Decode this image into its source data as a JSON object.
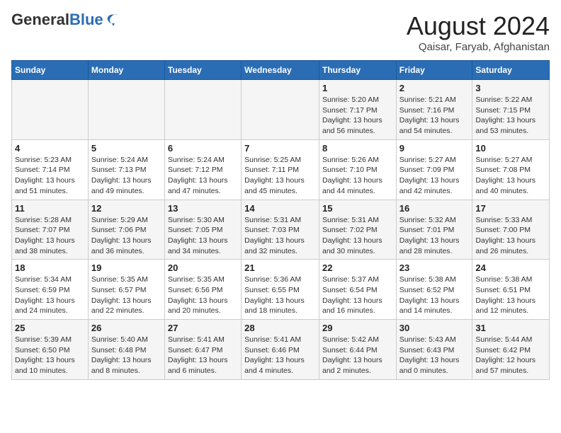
{
  "header": {
    "logo_general": "General",
    "logo_blue": "Blue",
    "main_title": "August 2024",
    "subtitle": "Qaisar, Faryab, Afghanistan"
  },
  "days_of_week": [
    "Sunday",
    "Monday",
    "Tuesday",
    "Wednesday",
    "Thursday",
    "Friday",
    "Saturday"
  ],
  "weeks": [
    {
      "days": [
        {
          "num": "",
          "info": ""
        },
        {
          "num": "",
          "info": ""
        },
        {
          "num": "",
          "info": ""
        },
        {
          "num": "",
          "info": ""
        },
        {
          "num": "1",
          "info": "Sunrise: 5:20 AM\nSunset: 7:17 PM\nDaylight: 13 hours\nand 56 minutes."
        },
        {
          "num": "2",
          "info": "Sunrise: 5:21 AM\nSunset: 7:16 PM\nDaylight: 13 hours\nand 54 minutes."
        },
        {
          "num": "3",
          "info": "Sunrise: 5:22 AM\nSunset: 7:15 PM\nDaylight: 13 hours\nand 53 minutes."
        }
      ]
    },
    {
      "days": [
        {
          "num": "4",
          "info": "Sunrise: 5:23 AM\nSunset: 7:14 PM\nDaylight: 13 hours\nand 51 minutes."
        },
        {
          "num": "5",
          "info": "Sunrise: 5:24 AM\nSunset: 7:13 PM\nDaylight: 13 hours\nand 49 minutes."
        },
        {
          "num": "6",
          "info": "Sunrise: 5:24 AM\nSunset: 7:12 PM\nDaylight: 13 hours\nand 47 minutes."
        },
        {
          "num": "7",
          "info": "Sunrise: 5:25 AM\nSunset: 7:11 PM\nDaylight: 13 hours\nand 45 minutes."
        },
        {
          "num": "8",
          "info": "Sunrise: 5:26 AM\nSunset: 7:10 PM\nDaylight: 13 hours\nand 44 minutes."
        },
        {
          "num": "9",
          "info": "Sunrise: 5:27 AM\nSunset: 7:09 PM\nDaylight: 13 hours\nand 42 minutes."
        },
        {
          "num": "10",
          "info": "Sunrise: 5:27 AM\nSunset: 7:08 PM\nDaylight: 13 hours\nand 40 minutes."
        }
      ]
    },
    {
      "days": [
        {
          "num": "11",
          "info": "Sunrise: 5:28 AM\nSunset: 7:07 PM\nDaylight: 13 hours\nand 38 minutes."
        },
        {
          "num": "12",
          "info": "Sunrise: 5:29 AM\nSunset: 7:06 PM\nDaylight: 13 hours\nand 36 minutes."
        },
        {
          "num": "13",
          "info": "Sunrise: 5:30 AM\nSunset: 7:05 PM\nDaylight: 13 hours\nand 34 minutes."
        },
        {
          "num": "14",
          "info": "Sunrise: 5:31 AM\nSunset: 7:03 PM\nDaylight: 13 hours\nand 32 minutes."
        },
        {
          "num": "15",
          "info": "Sunrise: 5:31 AM\nSunset: 7:02 PM\nDaylight: 13 hours\nand 30 minutes."
        },
        {
          "num": "16",
          "info": "Sunrise: 5:32 AM\nSunset: 7:01 PM\nDaylight: 13 hours\nand 28 minutes."
        },
        {
          "num": "17",
          "info": "Sunrise: 5:33 AM\nSunset: 7:00 PM\nDaylight: 13 hours\nand 26 minutes."
        }
      ]
    },
    {
      "days": [
        {
          "num": "18",
          "info": "Sunrise: 5:34 AM\nSunset: 6:59 PM\nDaylight: 13 hours\nand 24 minutes."
        },
        {
          "num": "19",
          "info": "Sunrise: 5:35 AM\nSunset: 6:57 PM\nDaylight: 13 hours\nand 22 minutes."
        },
        {
          "num": "20",
          "info": "Sunrise: 5:35 AM\nSunset: 6:56 PM\nDaylight: 13 hours\nand 20 minutes."
        },
        {
          "num": "21",
          "info": "Sunrise: 5:36 AM\nSunset: 6:55 PM\nDaylight: 13 hours\nand 18 minutes."
        },
        {
          "num": "22",
          "info": "Sunrise: 5:37 AM\nSunset: 6:54 PM\nDaylight: 13 hours\nand 16 minutes."
        },
        {
          "num": "23",
          "info": "Sunrise: 5:38 AM\nSunset: 6:52 PM\nDaylight: 13 hours\nand 14 minutes."
        },
        {
          "num": "24",
          "info": "Sunrise: 5:38 AM\nSunset: 6:51 PM\nDaylight: 13 hours\nand 12 minutes."
        }
      ]
    },
    {
      "days": [
        {
          "num": "25",
          "info": "Sunrise: 5:39 AM\nSunset: 6:50 PM\nDaylight: 13 hours\nand 10 minutes."
        },
        {
          "num": "26",
          "info": "Sunrise: 5:40 AM\nSunset: 6:48 PM\nDaylight: 13 hours\nand 8 minutes."
        },
        {
          "num": "27",
          "info": "Sunrise: 5:41 AM\nSunset: 6:47 PM\nDaylight: 13 hours\nand 6 minutes."
        },
        {
          "num": "28",
          "info": "Sunrise: 5:41 AM\nSunset: 6:46 PM\nDaylight: 13 hours\nand 4 minutes."
        },
        {
          "num": "29",
          "info": "Sunrise: 5:42 AM\nSunset: 6:44 PM\nDaylight: 13 hours\nand 2 minutes."
        },
        {
          "num": "30",
          "info": "Sunrise: 5:43 AM\nSunset: 6:43 PM\nDaylight: 13 hours\nand 0 minutes."
        },
        {
          "num": "31",
          "info": "Sunrise: 5:44 AM\nSunset: 6:42 PM\nDaylight: 12 hours\nand 57 minutes."
        }
      ]
    }
  ]
}
